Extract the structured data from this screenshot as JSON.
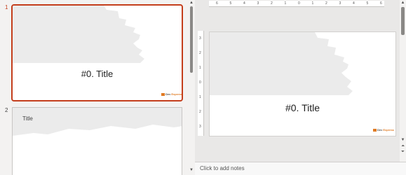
{
  "thumbnails": {
    "items": [
      {
        "number": "1",
        "title": "#0. Title"
      },
      {
        "number": "2",
        "title": "Title"
      }
    ],
    "logo": {
      "text_main": "Dev",
      "text_accent": "Express"
    }
  },
  "ruler": {
    "horizontal": [
      "6",
      "5",
      "4",
      "3",
      "2",
      "1",
      "0",
      "1",
      "2",
      "3",
      "4",
      "5",
      "6"
    ],
    "vertical": [
      "3",
      "2",
      "1",
      "0",
      "1",
      "2",
      "3"
    ]
  },
  "slide": {
    "title": "#0. Title"
  },
  "notes": {
    "placeholder": "Click to add notes"
  },
  "colors": {
    "accent": "#c43e1c",
    "brush": "#ebebeb",
    "logo": "#e07b24"
  }
}
